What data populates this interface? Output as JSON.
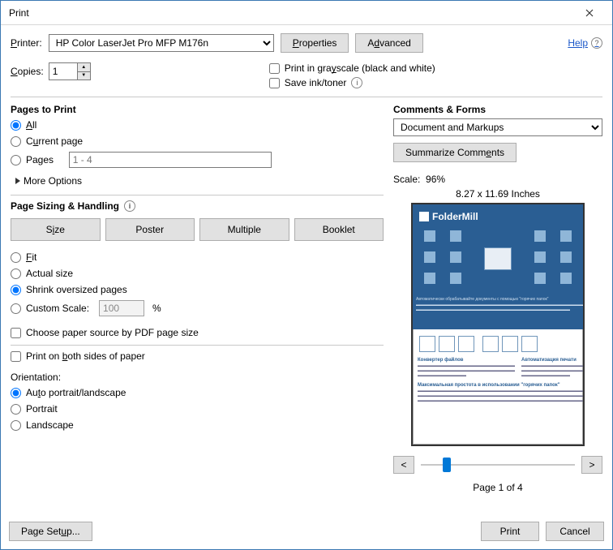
{
  "window": {
    "title": "Print"
  },
  "header": {
    "printer_label": "Printer:",
    "printer_value": "HP Color LaserJet Pro MFP M176n",
    "properties_btn": "Properties",
    "advanced_btn": "Advanced",
    "help_link": "Help",
    "copies_label": "Copies:",
    "copies_value": "1",
    "grayscale_label": "Print in grayscale (black and white)",
    "save_ink_label": "Save ink/toner"
  },
  "pages_to_print": {
    "title": "Pages to Print",
    "all": "All",
    "current": "Current page",
    "pages_label": "Pages",
    "pages_placeholder": "1 - 4",
    "more_options": "More Options"
  },
  "sizing": {
    "title": "Page Sizing & Handling",
    "size_btn": "Size",
    "poster_btn": "Poster",
    "multiple_btn": "Multiple",
    "booklet_btn": "Booklet",
    "fit": "Fit",
    "actual": "Actual size",
    "shrink": "Shrink oversized pages",
    "custom_scale": "Custom Scale:",
    "custom_scale_value": "100",
    "percent": "%",
    "paper_source": "Choose paper source by PDF page size",
    "both_sides": "Print on both sides of paper",
    "orientation_label": "Orientation:",
    "auto": "Auto portrait/landscape",
    "portrait": "Portrait",
    "landscape": "Landscape"
  },
  "comments": {
    "title": "Comments & Forms",
    "value": "Document and Markups",
    "summarize_btn": "Summarize Comments"
  },
  "preview": {
    "scale_label": "Scale:",
    "scale_value": "96%",
    "dimensions": "8.27 x 11.69 Inches",
    "doc_logo": "FolderMill",
    "page_indicator": "Page 1 of 4",
    "prev": "<",
    "next": ">"
  },
  "footer": {
    "page_setup": "Page Setup...",
    "print": "Print",
    "cancel": "Cancel"
  }
}
